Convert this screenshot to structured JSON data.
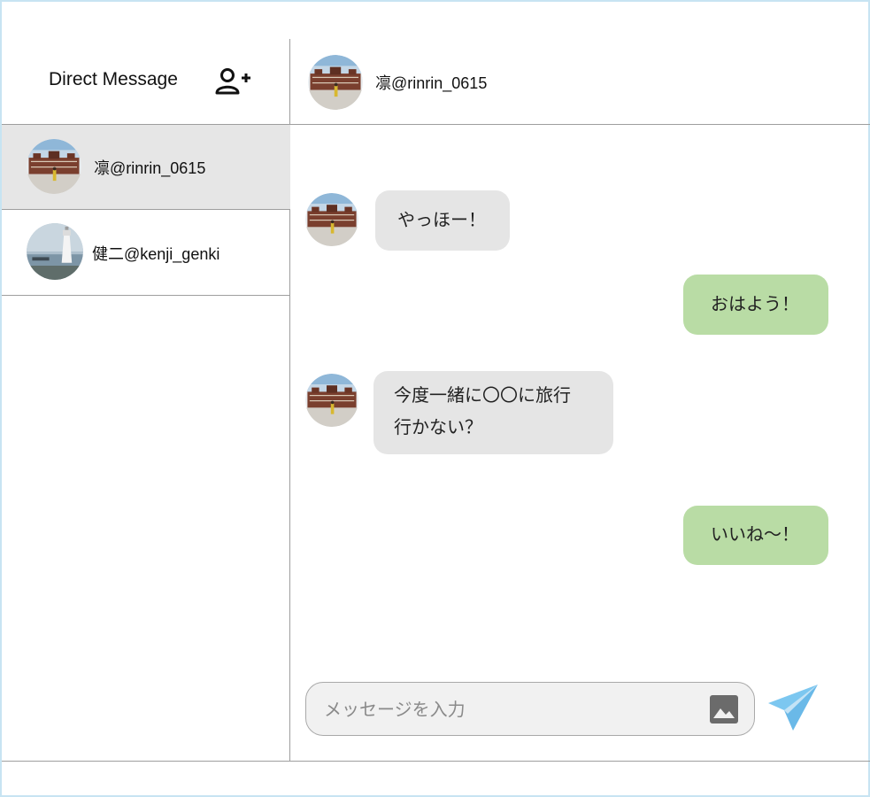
{
  "sidebar": {
    "title": "Direct Message",
    "add_icon": "user-plus-icon",
    "conversations": [
      {
        "name": "凛@rinrin_0615",
        "avatar": "station-photo",
        "active": true
      },
      {
        "name": "健二@kenji_genki",
        "avatar": "lighthouse-photo",
        "active": false
      }
    ]
  },
  "chat": {
    "header_name": "凛@rinrin_0615",
    "messages": [
      {
        "from": "contact",
        "text": "やっほー！"
      },
      {
        "from": "me",
        "text": "おはよう！"
      },
      {
        "from": "contact",
        "lines": [
          "今度一緒に〇〇に旅行",
          "行かない？"
        ]
      },
      {
        "from": "me",
        "text": "いいね〜！"
      }
    ],
    "input_placeholder": "メッセージを入力",
    "image_icon": "image-icon",
    "send_icon": "send-icon"
  },
  "colors": {
    "incoming_bubble": "#e5e5e5",
    "outgoing_bubble": "#b9dca5",
    "active_conversation": "#e6e6e6",
    "send_icon": "#7cc7f0",
    "frame_border": "#c7e4f2"
  }
}
